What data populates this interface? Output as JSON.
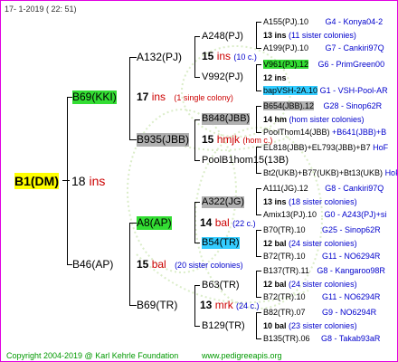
{
  "header": {
    "date": "17-  1-2019 ( 22: 51)"
  },
  "footer": {
    "copyright": "Copyright 2004-2019 @ Karl Kehrle Foundation",
    "site": "www.pedigreeapis.org"
  },
  "root": {
    "name": "B1(DM)",
    "year": "18",
    "ins": "ins"
  },
  "g1": [
    {
      "name": "B69(KKI)",
      "year": "17",
      "ins": "ins",
      "note": "(1 single colony)"
    },
    {
      "name": "B46(AP)",
      "year": "15",
      "ins": "bal",
      "note": "(20 sister colonies)"
    }
  ],
  "g2": [
    {
      "name": "A132(PJ)",
      "year": "",
      "note": ""
    },
    {
      "name": "B935(JBB)",
      "year": "",
      "note": ""
    },
    {
      "name": "A8(AP)",
      "year": "14",
      "ins": "bal",
      "note": "(22 c.)"
    },
    {
      "name": "B69(TR)",
      "year": "13",
      "ins": "mrk",
      "note": "(24 c.)"
    }
  ],
  "g3": [
    {
      "name": "A248(PJ)"
    },
    {
      "name": "15",
      "ins": "ins",
      "note": "(10 c.)"
    },
    {
      "name": "V992(PJ)"
    },
    {
      "name": "B848(JBB)"
    },
    {
      "name": "15",
      "ins": "hmjk",
      "note": "(hom c.)"
    },
    {
      "name": "PoolB1hom15(13B)"
    },
    {
      "name": "A322(JG)"
    },
    {
      "name": "B54(TR)"
    },
    {
      "name": "B63(TR)"
    },
    {
      "name": "B129(TR)"
    }
  ],
  "g4": [
    {
      "name": "A155(PJ).10",
      "src": "G4 - Konya04-2"
    },
    {
      "name": "13 ins",
      "note": "(11 sister colonies)"
    },
    {
      "name": "A199(PJ).10",
      "src": "G7 - Cankiri97Q"
    },
    {
      "name": "V961(PJ).12",
      "src": "G6 - PrimGreen00"
    },
    {
      "name": "12 ins",
      "note": ""
    },
    {
      "name": "bapVSH-2A.10",
      "src": "G1 - VSH-Pool-AR"
    },
    {
      "name": "B654(JBB).12",
      "src": "G28 - Sinop62R"
    },
    {
      "name": "14 hm",
      "note": "(hom sister colonies)"
    },
    {
      "name": "PoolThom14(JBB)",
      "src": "+B641(JBB)+B"
    },
    {
      "name": "EL818(JBB)+EL793(JBB)+B7",
      "src": "HoF"
    },
    {
      "name": "Bt2(UKB)+B77(UKB)+Bt13(UKB)",
      "src": "HoF"
    },
    {
      "name": "A111(JG).12",
      "src": "G8 - Cankiri97Q"
    },
    {
      "name": "13 ins",
      "note": "(18 sister colonies)"
    },
    {
      "name": "Amix13(PJ).10",
      "src": "G0 - A243(PJ)+si"
    },
    {
      "name": "B70(TR).10",
      "src": "G25 - Sinop62R"
    },
    {
      "name": "12 bal",
      "note": "(24 sister colonies)"
    },
    {
      "name": "B72(TR).10",
      "src": "G11 - NO6294R"
    },
    {
      "name": "B137(TR).11",
      "src": "G8 - Kangaroo98R"
    },
    {
      "name": "12 bal",
      "note": "(24 sister colonies)"
    },
    {
      "name": "B72(TR).10",
      "src": "G11 - NO6294R"
    },
    {
      "name": "B82(TR).07",
      "src": "G9 - NO6294R"
    },
    {
      "name": "10 bal",
      "note": "(23 sister colonies)"
    },
    {
      "name": "B135(TR).06",
      "src": "G8 - Takab93aR"
    }
  ]
}
